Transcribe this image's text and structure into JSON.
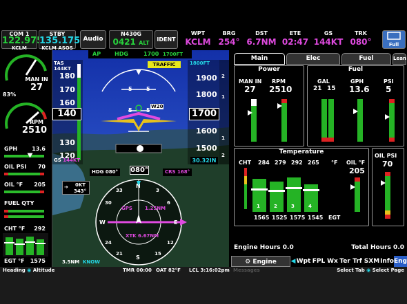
{
  "radios": {
    "com1": {
      "label": "COM 1",
      "freq": "122.975",
      "id": "KCLM UNICOM"
    },
    "stby": {
      "label": "STBY",
      "freq": "135.175",
      "id": "KCLM ASOS"
    },
    "audio": "Audio"
  },
  "transponder": {
    "label": "N430G",
    "code": "0421",
    "mode": "ALT",
    "ident": "IDENT"
  },
  "nav": {
    "headers": [
      "WPT",
      "BRG",
      "DST",
      "ETE",
      "GS",
      "TRK"
    ],
    "values": [
      "KCLM",
      "254°",
      "6.7NM",
      "02:47",
      "144KT",
      "080°"
    ]
  },
  "full_button": "Full",
  "strip": {
    "man_in": {
      "label": "MAN IN",
      "value": "27"
    },
    "percent": "83%",
    "rpm": {
      "label": "RPM",
      "value": "2510"
    },
    "gph": {
      "label": "GPH",
      "value": "13.6"
    },
    "oil_psi": {
      "label": "OIL PSI",
      "value": "70"
    },
    "oil_f": {
      "label": "OIL °F",
      "value": "205"
    },
    "fuel_qty": {
      "label": "FUEL QTY"
    },
    "cht": {
      "label": "CHT °F",
      "value": "292"
    },
    "egt": {
      "label": "EGT °F",
      "value": "1575"
    }
  },
  "pfd": {
    "ap": "AP",
    "hdg": "HDG",
    "alt": "1700",
    "alt_sel": "1700FT",
    "tas_label": "TAS",
    "tas": "144KT",
    "traffic": "TRAFFIC",
    "speed_ticks": [
      "180",
      "170",
      "160",
      "150",
      "140",
      "130",
      "120",
      "110"
    ],
    "speed": "140",
    "alt_target": "1800FT",
    "alt_ticks": [
      "1900",
      "1800",
      "1700",
      "1600",
      "1500"
    ],
    "baro": "30.32IN",
    "gs_label": "GS",
    "gs": "144KT",
    "pitch_ticks": [
      "5",
      "5",
      "5",
      "5"
    ],
    "w20": "W20",
    "hdg_bug": "HDG 080°",
    "heading": "080°",
    "crs": "CRS 168°",
    "wind_speed": "0KT",
    "wind_dir": "343°",
    "compass": [
      "N",
      "E",
      "S",
      "W",
      "3",
      "6",
      "12",
      "15",
      "21",
      "24",
      "30",
      "33"
    ],
    "gps": "GPS",
    "cdi_scale": "1.25NM",
    "xtk": "XTK 6.67NM",
    "range": "3.5NM",
    "know": "KNOW",
    "vsi": [
      "2",
      "1",
      "1",
      "2"
    ]
  },
  "mfd": {
    "tabs": [
      "Main",
      "Elec",
      "Fuel",
      "Lean"
    ],
    "power_title": "Power",
    "fuel_title": "Fuel",
    "man_in": {
      "label": "MAN IN",
      "value": "27"
    },
    "rpm": {
      "label": "RPM",
      "value": "2510"
    },
    "gal": {
      "label": "GAL",
      "left": "21",
      "right": "15"
    },
    "gph": {
      "label": "GPH",
      "value": "13.6"
    },
    "psi": {
      "label": "PSI",
      "value": "5"
    },
    "temp_title": "Temperature",
    "cht_label": "CHT",
    "cht_values": [
      "284",
      "279",
      "292",
      "265"
    ],
    "cht_unit": "°F",
    "egt_values": [
      "1565",
      "1525",
      "1575",
      "1545"
    ],
    "egt_label": "EGT",
    "cyl_numbers": [
      "1",
      "2",
      "3",
      "4"
    ],
    "oil_f": {
      "label": "OIL °F",
      "value": "205"
    },
    "oil_psi": {
      "label": "OIL PSI",
      "value": "70"
    },
    "engine_hours": "Engine Hours 0.0",
    "total_hours": "Total Hours 0.0"
  },
  "softkeys": {
    "engine": "Engine",
    "items": [
      "Wpt",
      "FPL",
      "Wx",
      "Ter",
      "Trf",
      "SXM",
      "Info",
      "Eng"
    ],
    "messages": "Messages"
  },
  "status": {
    "left1": "Heading",
    "left2": "Altitude",
    "tmr": "TMR",
    "tmr_val": "00:00",
    "oat": "OAT",
    "oat_val": "82°F",
    "lcl": "LCL",
    "time": "3:16:02pm",
    "select_tab": "Select Tab",
    "select_page": "Select Page"
  },
  "colors": {
    "green": "#27d13c",
    "magenta": "#e04ae0",
    "cyan": "#24d7e6",
    "amber": "#e8c21c",
    "red": "#d22222"
  }
}
